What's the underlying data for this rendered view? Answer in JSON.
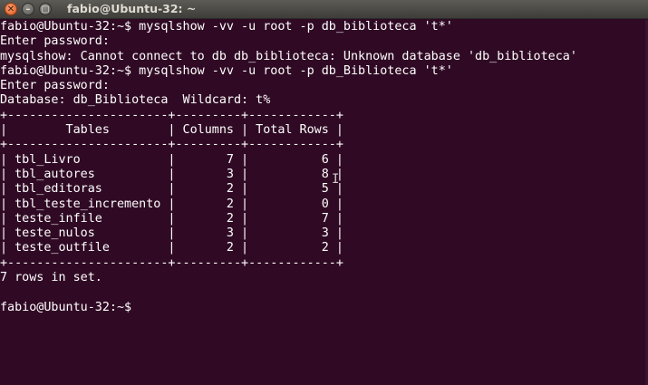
{
  "window": {
    "title": "fabio@Ubuntu-32: ~",
    "close_glyph": "✕",
    "minimize_glyph": "–",
    "maximize_glyph": "▢"
  },
  "terminal": {
    "lines": [
      "fabio@Ubuntu-32:~$ mysqlshow -vv -u root -p db_biblioteca 't*'",
      "Enter password:",
      "mysqlshow: Cannot connect to db db_biblioteca: Unknown database 'db_biblioteca'",
      "fabio@Ubuntu-32:~$ mysqlshow -vv -u root -p db_Biblioteca 't*'",
      "Enter password:",
      "Database: db_Biblioteca  Wildcard: t%",
      "+----------------------+---------+------------+",
      "|        Tables        | Columns | Total Rows |",
      "+----------------------+---------+------------+",
      "| tbl_Livro            |       7 |          6 |",
      "| tbl_autores          |       3 |          8 |",
      "| tbl_editoras         |       2 |          5 |",
      "| tbl_teste_incremento |       2 |          0 |",
      "| teste_infile         |       2 |          7 |",
      "| teste_nulos          |       3 |          3 |",
      "| teste_outfile        |       2 |          2 |",
      "+----------------------+---------+------------+",
      "7 rows in set.",
      "",
      "fabio@Ubuntu-32:~$"
    ]
  },
  "cursor": {
    "glyph": "I"
  },
  "colors": {
    "background": "#300a24",
    "text": "#ffffff",
    "titlebar": "#4a4945"
  }
}
